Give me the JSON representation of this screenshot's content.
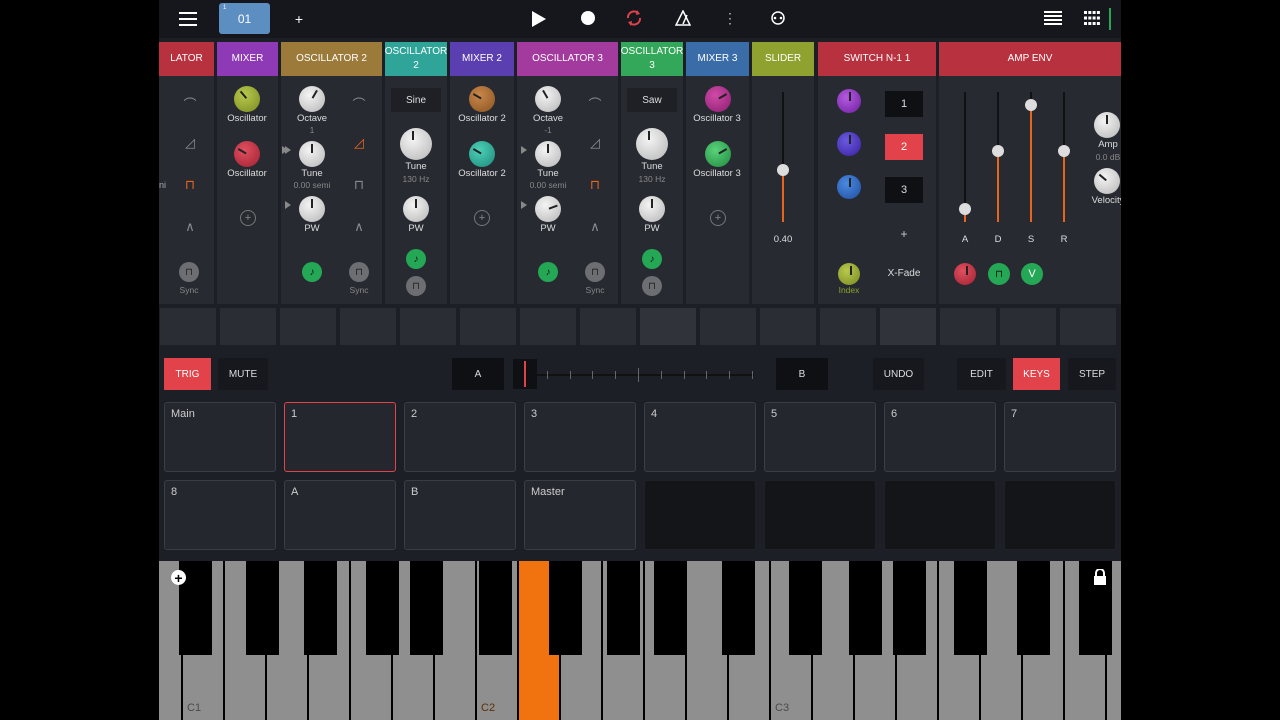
{
  "topbar": {
    "patch_number": "01",
    "patch_small": "1",
    "add_label": "+",
    "icons": [
      "menu-icon",
      "play-icon",
      "record-icon",
      "loop-icon",
      "metronome-icon",
      "more-vert-icon",
      "link-icon",
      "list-icon",
      "grid-icon"
    ]
  },
  "modules": {
    "osc1": {
      "title": "LATOR",
      "wave_labels": [
        "⌒",
        "◿",
        "⊓",
        "∧"
      ],
      "side_label": "ni",
      "sync": "Sync",
      "color": "#b8313f"
    },
    "mixer1": {
      "title": "MIXER",
      "k1": "Oscillator",
      "k2": "Oscillator",
      "color": "#8e3ab7"
    },
    "osc2": {
      "title": "OSCILLATOR 2",
      "octave": "Octave",
      "octave_val": "1",
      "tune": "Tune",
      "tune_val": "0.00 semi",
      "pw": "PW",
      "sync": "Sync",
      "color": "#9b7a3a"
    },
    "osc2b": {
      "title": "OSCILLATOR\n2",
      "shape": "Sine",
      "tune": "Tune",
      "tune_val": "130 Hz",
      "pw": "PW",
      "color": "#2fa59a"
    },
    "mixer2": {
      "title": "MIXER 2",
      "k1": "Oscillator 2",
      "k2": "Oscillator 2",
      "color": "#5b3fb0"
    },
    "osc3": {
      "title": "OSCILLATOR 3",
      "octave": "Octave",
      "octave_val": "-1",
      "tune": "Tune",
      "tune_val": "0.00 semi",
      "pw": "PW",
      "sync": "Sync",
      "color": "#a33a9e"
    },
    "osc3b": {
      "title": "OSCILLATOR\n3",
      "shape": "Saw",
      "tune": "Tune",
      "tune_val": "130 Hz",
      "pw": "PW",
      "color": "#34a85a"
    },
    "mixer3": {
      "title": "MIXER 3",
      "k1": "Oscillator 3",
      "k2": "Oscillator 3",
      "color": "#3a6ca8"
    },
    "slider": {
      "title": "SLIDER",
      "value": "0.40",
      "value_fraction": 0.4,
      "color": "#8fa12e"
    },
    "switch": {
      "title": "SWITCH N-1 1",
      "options": [
        "1",
        "2",
        "3"
      ],
      "selected": "2",
      "add": "+",
      "xfade": "X-Fade",
      "index": "Index",
      "color": "#b8313f"
    },
    "ampenv": {
      "title": "AMP ENV",
      "labels": [
        "A",
        "D",
        "S",
        "R"
      ],
      "levels": [
        0.1,
        0.55,
        0.9,
        0.55
      ],
      "amp": "Amp",
      "amp_val": "0.0 dB",
      "vel": "Velocity",
      "v_btn": "V",
      "color": "#b8313f"
    }
  },
  "transport": {
    "trig": "TRIG",
    "mute": "MUTE",
    "a": "A",
    "b": "B",
    "undo": "UNDO",
    "edit": "EDIT",
    "keys": "KEYS",
    "step": "STEP"
  },
  "pads_row1": [
    "Main",
    "1",
    "2",
    "3",
    "4",
    "5",
    "6",
    "7"
  ],
  "pads_row2": [
    "8",
    "A",
    "B",
    "Master",
    "",
    "",
    "",
    ""
  ],
  "keyboard": {
    "c1": "C1",
    "c2": "C2",
    "c3": "C3"
  }
}
